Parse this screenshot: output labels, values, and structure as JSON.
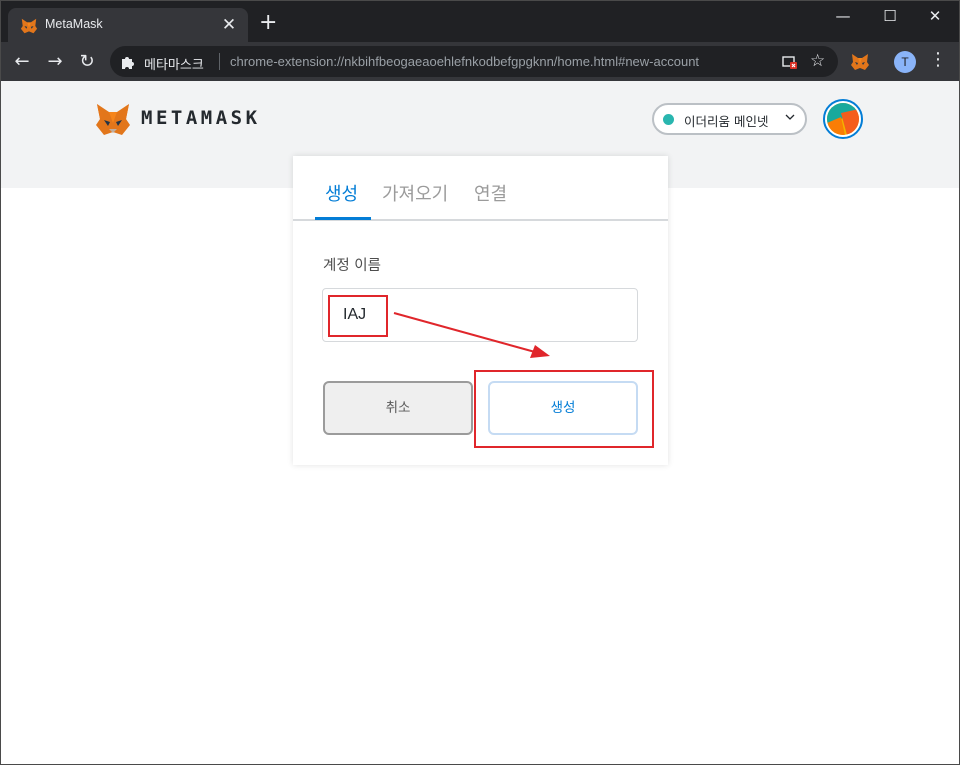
{
  "browser": {
    "tab_title": "MetaMask",
    "tab_close": "✕",
    "new_tab": "+",
    "window_minimize": "—",
    "window_maximize": "☐",
    "window_close": "✕",
    "site_name": "메타마스크",
    "url": "chrome-extension://nkbihfbeogaeaoehlefnkodbefgpgknn/home.html#new-account",
    "profile_initial": "T",
    "nav": {
      "back": "←",
      "forward": "→",
      "reload": "↻"
    },
    "star": "☆",
    "menu": "⋮"
  },
  "header": {
    "brand": "METAMASK",
    "network_label": "이더리움 메인넷",
    "network_dot_color": "#29b6af"
  },
  "card": {
    "tabs": [
      {
        "label": "생성",
        "active": true
      },
      {
        "label": "가져오기",
        "active": false
      },
      {
        "label": "연결",
        "active": false
      }
    ],
    "field_label": "계정 이름",
    "input_value": "IAJ",
    "cancel_label": "취소",
    "create_label": "생성"
  },
  "colors": {
    "accent": "#037dd6",
    "annotation": "#e0262b"
  }
}
